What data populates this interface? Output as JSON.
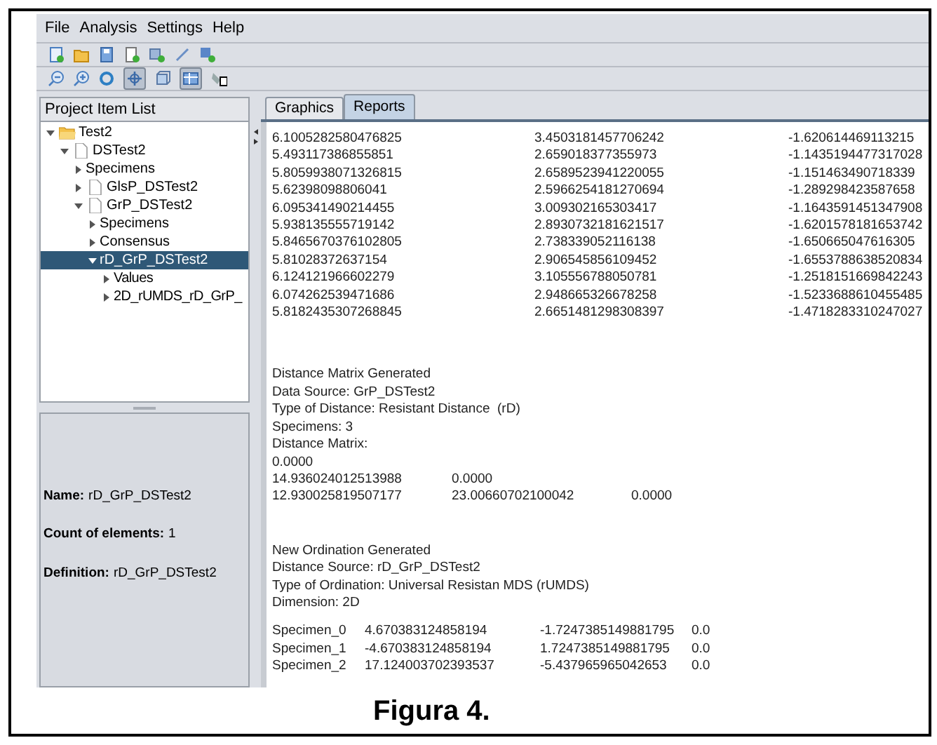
{
  "menu": [
    "File",
    "Analysis",
    "Settings",
    "Help"
  ],
  "project_panel": {
    "title": "Project Item List",
    "tree": [
      {
        "label": "Test2",
        "kind": "folder",
        "expanded": true,
        "selected": false,
        "children": [
          {
            "label": "DSTest2",
            "kind": "file",
            "expanded": true,
            "selected": false,
            "children": [
              {
                "label": "Specimens",
                "expanded": false,
                "selected": false
              },
              {
                "label": "GlsP_DSTest2",
                "kind": "file",
                "expanded": false,
                "selected": false
              },
              {
                "label": "GrP_DSTest2",
                "kind": "file",
                "expanded": true,
                "selected": false,
                "children": [
                  {
                    "label": "Specimens",
                    "expanded": false,
                    "selected": false
                  },
                  {
                    "label": "Consensus",
                    "expanded": false,
                    "selected": false
                  },
                  {
                    "label": "rD_GrP_DSTest2",
                    "expanded": true,
                    "selected": true,
                    "children": [
                      {
                        "label": "Values",
                        "expanded": false,
                        "selected": false
                      },
                      {
                        "label": "2D_rUMDS_rD_GrP_",
                        "expanded": false,
                        "selected": false
                      }
                    ]
                  }
                ]
              }
            ]
          }
        ]
      }
    ],
    "properties": [
      {
        "label": "Name:",
        "value": "rD_GrP_DSTest2"
      },
      {
        "label": "Count of elements:",
        "value": "1"
      },
      {
        "label": "Definition:",
        "value": "rD_GrP_DSTest2"
      }
    ]
  },
  "tabs": [
    {
      "label": "Graphics",
      "selected": false
    },
    {
      "label": "Reports",
      "selected": true
    }
  ],
  "report": {
    "values": [
      [
        "6.1005282580476825",
        "3.4503181457706242",
        "-1.620614469113215"
      ],
      [
        "5.493117386855851",
        "2.659018377355973",
        "-1.1435194477317028"
      ],
      [
        "5.8059938071326815",
        "2.6589523941220055",
        "-1.151463490718339"
      ],
      [
        "5.62398098806041",
        "2.5966254181270694",
        "-1.289298423587658"
      ],
      [
        "6.095341490214455",
        "3.009302165303417",
        "-1.1643591451347908"
      ],
      [
        "5.938135555719142",
        "2.8930732181621517",
        "-1.6201578181653742"
      ],
      [
        "5.8465670376102805",
        "2.738339052116138",
        "-1.650665047616305"
      ],
      [
        "5.81028372637154",
        "2.906545856109452",
        "-1.6553788638520834"
      ],
      [
        "6.124121966602279",
        "3.105556788050781",
        "-1.2518151669842243"
      ],
      [
        "6.074262539471686",
        "2.948665326678258",
        "-1.5233688610455485"
      ],
      [
        "5.8182435307268845",
        "2.6651481298308397",
        "-1.4718283310247027"
      ]
    ],
    "distance_lines": [
      "Distance Matrix Generated",
      "Data Source: GrP_DSTest2",
      "Type of Distance: Resistant Distance  (rD)",
      "Specimens: 3",
      "Distance Matrix:"
    ],
    "matrix": [
      [
        "0.0000"
      ],
      [
        "14.936024012513988",
        "0.0000"
      ],
      [
        "12.930025819507177",
        "23.00660702100042",
        "0.0000"
      ]
    ],
    "ordination_lines": [
      "New Ordination Generated",
      "Distance Source: rD_GrP_DSTest2",
      "Type of Ordination: Universal Resistan MDS (rUMDS)",
      "Dimension: 2D"
    ],
    "ordination": [
      [
        "Specimen_0",
        "4.670383124858194",
        "-1.7247385149881795",
        "0.0"
      ],
      [
        "Specimen_1",
        "-4.670383124858194",
        "1.7247385149881795",
        "0.0"
      ],
      [
        "Specimen_2",
        "17.124003702393537",
        "-5.437965965042653",
        "0.0"
      ]
    ]
  },
  "caption": "Figura 4."
}
